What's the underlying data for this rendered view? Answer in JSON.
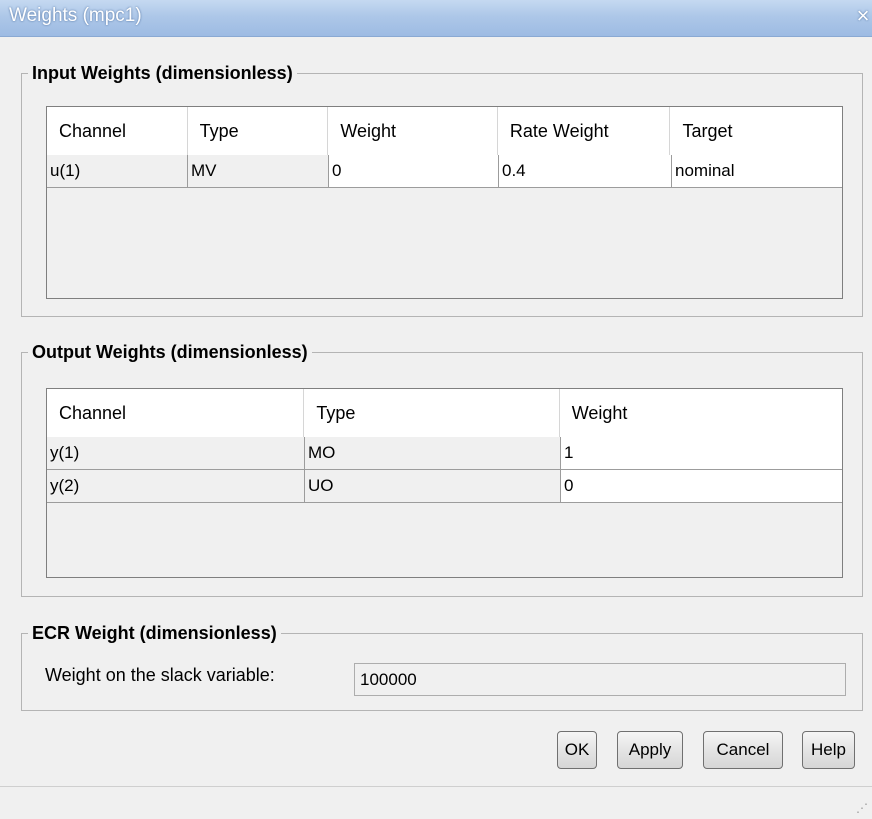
{
  "window": {
    "title": "Weights (mpc1)",
    "close_glyph": "×"
  },
  "input_weights": {
    "title": "Input Weights (dimensionless)",
    "columns": [
      "Channel",
      "Type",
      "Weight",
      "Rate Weight",
      "Target"
    ],
    "rows": [
      [
        "u(1)",
        "MV",
        "0",
        "0.4",
        "nominal"
      ]
    ]
  },
  "output_weights": {
    "title": "Output Weights (dimensionless)",
    "columns": [
      "Channel",
      "Type",
      "Weight"
    ],
    "rows": [
      [
        "y(1)",
        "MO",
        "1"
      ],
      [
        "y(2)",
        "UO",
        "0"
      ]
    ]
  },
  "ecr_weight": {
    "title": "ECR Weight (dimensionless)",
    "label": "Weight on the slack variable:",
    "value": "100000"
  },
  "buttons": {
    "ok": "OK",
    "apply": "Apply",
    "cancel": "Cancel",
    "help": "Help"
  },
  "icons": {
    "close": "close-icon",
    "resize": "resize-grip-icon"
  },
  "colors": {
    "titlebar": "#adc7e8",
    "background": "#f0f0f0",
    "editable_cell": "#ffffff"
  }
}
